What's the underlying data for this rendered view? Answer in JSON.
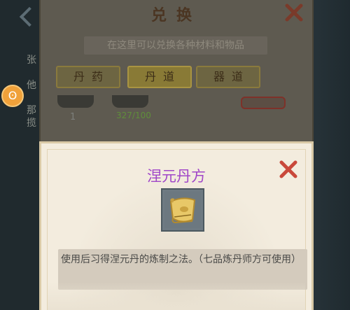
{
  "background": {
    "side_text": [
      "张",
      "他",
      "那",
      "揽"
    ],
    "pet_icon": "pet-face-icon"
  },
  "exchange": {
    "title": "兑换",
    "subtitle": "在这里可以兑换各种材料和物品",
    "tabs": [
      {
        "label": "丹药",
        "active": false
      },
      {
        "label": "丹道",
        "active": true
      },
      {
        "label": "器道",
        "active": false
      }
    ],
    "slot_count": "1",
    "slot_have": "327/100",
    "close_icon": "close-x-icon"
  },
  "popup": {
    "title": "涅元丹方",
    "item_icon": "recipe-scroll-icon",
    "description": "使用后习得涅元丹的炼制之法。（七品炼丹师方可使用）",
    "close_icon": "close-x-icon",
    "title_color": "#a046c8"
  }
}
